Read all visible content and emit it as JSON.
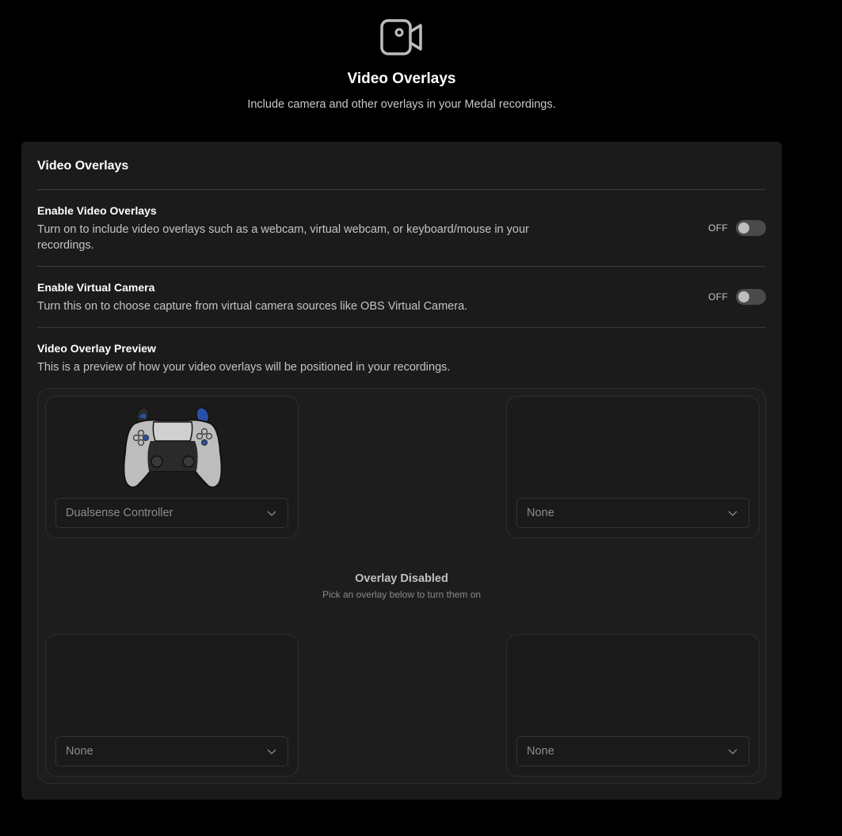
{
  "header": {
    "icon": "video-camera-icon",
    "title": "Video Overlays",
    "subtitle": "Include camera and other overlays in your Medal recordings."
  },
  "panel": {
    "title": "Video Overlays",
    "settings": [
      {
        "title": "Enable Video Overlays",
        "description": "Turn on to include video overlays such as a webcam, virtual webcam, or keyboard/mouse in your recordings.",
        "toggle_label": "OFF",
        "enabled": false
      },
      {
        "title": "Enable Virtual Camera",
        "description": "Turn this on to choose capture from virtual camera sources like OBS Virtual Camera.",
        "toggle_label": "OFF",
        "enabled": false
      }
    ],
    "preview": {
      "title": "Video Overlay Preview",
      "description": "This is a preview of how your video overlays will be positioned in your recordings.",
      "status_title": "Overlay Disabled",
      "status_subtitle": "Pick an overlay below to turn them on",
      "slots": {
        "top_left": {
          "value": "Dualsense Controller",
          "image": "dualsense-controller-icon"
        },
        "top_right": {
          "value": "None"
        },
        "bottom_left": {
          "value": "None"
        },
        "bottom_right": {
          "value": "None"
        }
      }
    }
  },
  "colors": {
    "background": "#000000",
    "panel": "#1b1b1b",
    "divider": "#3a3a3a",
    "toggle_off": "#4a4a4a",
    "controller_accent": "#2b4fa8"
  }
}
